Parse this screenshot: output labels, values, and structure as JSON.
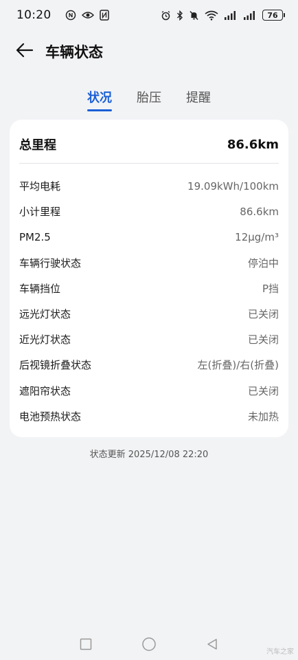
{
  "status_bar": {
    "time": "10:20",
    "battery": "76",
    "icons_left": [
      "nfc-circle-icon",
      "eye-icon",
      "nfc-icon"
    ],
    "icons_right": [
      "alarm-icon",
      "bluetooth-icon",
      "mute-icon",
      "wifi-icon",
      "signal-icon",
      "signal-icon"
    ]
  },
  "header": {
    "title": "车辆状态",
    "back_icon": "back-arrow-icon"
  },
  "tabs": [
    {
      "label": "状况",
      "active": true
    },
    {
      "label": "胎压",
      "active": false
    },
    {
      "label": "提醒",
      "active": false
    }
  ],
  "card": {
    "total": {
      "label": "总里程",
      "value": "86.6km"
    },
    "rows": [
      {
        "label": "平均电耗",
        "value": "19.09kWh/100km"
      },
      {
        "label": "小计里程",
        "value": "86.6km"
      },
      {
        "label": "PM2.5",
        "value": "12μg/m³"
      },
      {
        "label": "车辆行驶状态",
        "value": "停泊中"
      },
      {
        "label": "车辆挡位",
        "value": "P挡"
      },
      {
        "label": "远光灯状态",
        "value": "已关闭"
      },
      {
        "label": "近光灯状态",
        "value": "已关闭"
      },
      {
        "label": "后视镜折叠状态",
        "value": "左(折叠)/右(折叠)"
      },
      {
        "label": "遮阳帘状态",
        "value": "已关闭"
      },
      {
        "label": "电池预热状态",
        "value": "未加热"
      }
    ]
  },
  "footer": {
    "updated": "状态更新 2025/12/08 22:20"
  },
  "navbar": {
    "icons": [
      "recent-apps-icon",
      "home-icon",
      "back-icon"
    ]
  },
  "watermark": "汽车之家",
  "colors": {
    "accent": "#1a5fd6",
    "background": "#f2f3f5",
    "card": "#ffffff"
  }
}
